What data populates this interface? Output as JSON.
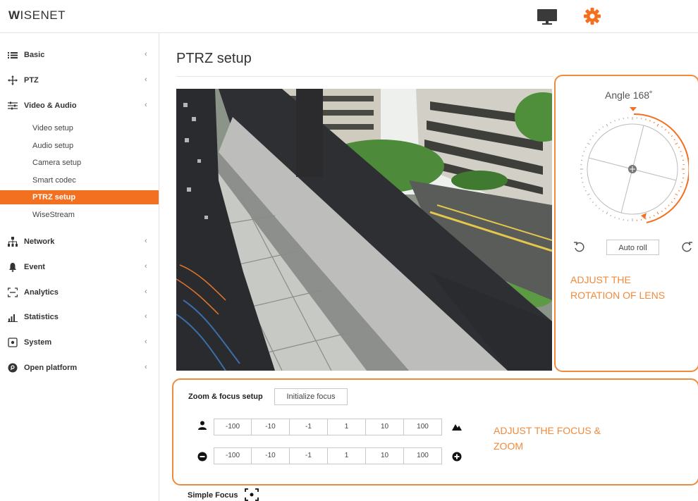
{
  "brand": {
    "logo_bold": "W",
    "logo_rest": "ISENET"
  },
  "colors": {
    "accent": "#f37021",
    "annotation": "#f08a3c"
  },
  "topbar": {
    "icons": [
      "monitor-icon",
      "gear-icon"
    ]
  },
  "sidebar": {
    "items": [
      {
        "label": "Basic",
        "icon": "list-icon"
      },
      {
        "label": "PTZ",
        "icon": "move-icon"
      },
      {
        "label": "Video & Audio",
        "icon": "sliders-icon"
      },
      {
        "label": "Network",
        "icon": "network-icon"
      },
      {
        "label": "Event",
        "icon": "bell-icon"
      },
      {
        "label": "Analytics",
        "icon": "analytics-icon"
      },
      {
        "label": "Statistics",
        "icon": "bar-chart-icon"
      },
      {
        "label": "System",
        "icon": "system-icon"
      },
      {
        "label": "Open platform",
        "icon": "open-platform-icon"
      }
    ],
    "chevron": "‹",
    "sub_items": [
      "Video setup",
      "Audio setup",
      "Camera setup",
      "Smart codec",
      "PTRZ setup",
      "WiseStream"
    ],
    "active_sub": "PTRZ setup"
  },
  "main": {
    "title": "PTRZ setup"
  },
  "roll": {
    "angle_label": "Angle 168˚",
    "auto_roll_label": "Auto roll",
    "annotation": "ADJUST THE\nROTATION OF LENS"
  },
  "zoom_focus": {
    "label": "Zoom & focus setup",
    "initialize_label": "Initialize focus",
    "zoom_steps": [
      "-100",
      "-10",
      "-1",
      "1",
      "10",
      "100"
    ],
    "focus_steps": [
      "-100",
      "-10",
      "-1",
      "1",
      "10",
      "100"
    ],
    "annotation": "ADJUST THE FOCUS &\nZOOM"
  },
  "simple_focus": {
    "label": "Simple Focus"
  }
}
